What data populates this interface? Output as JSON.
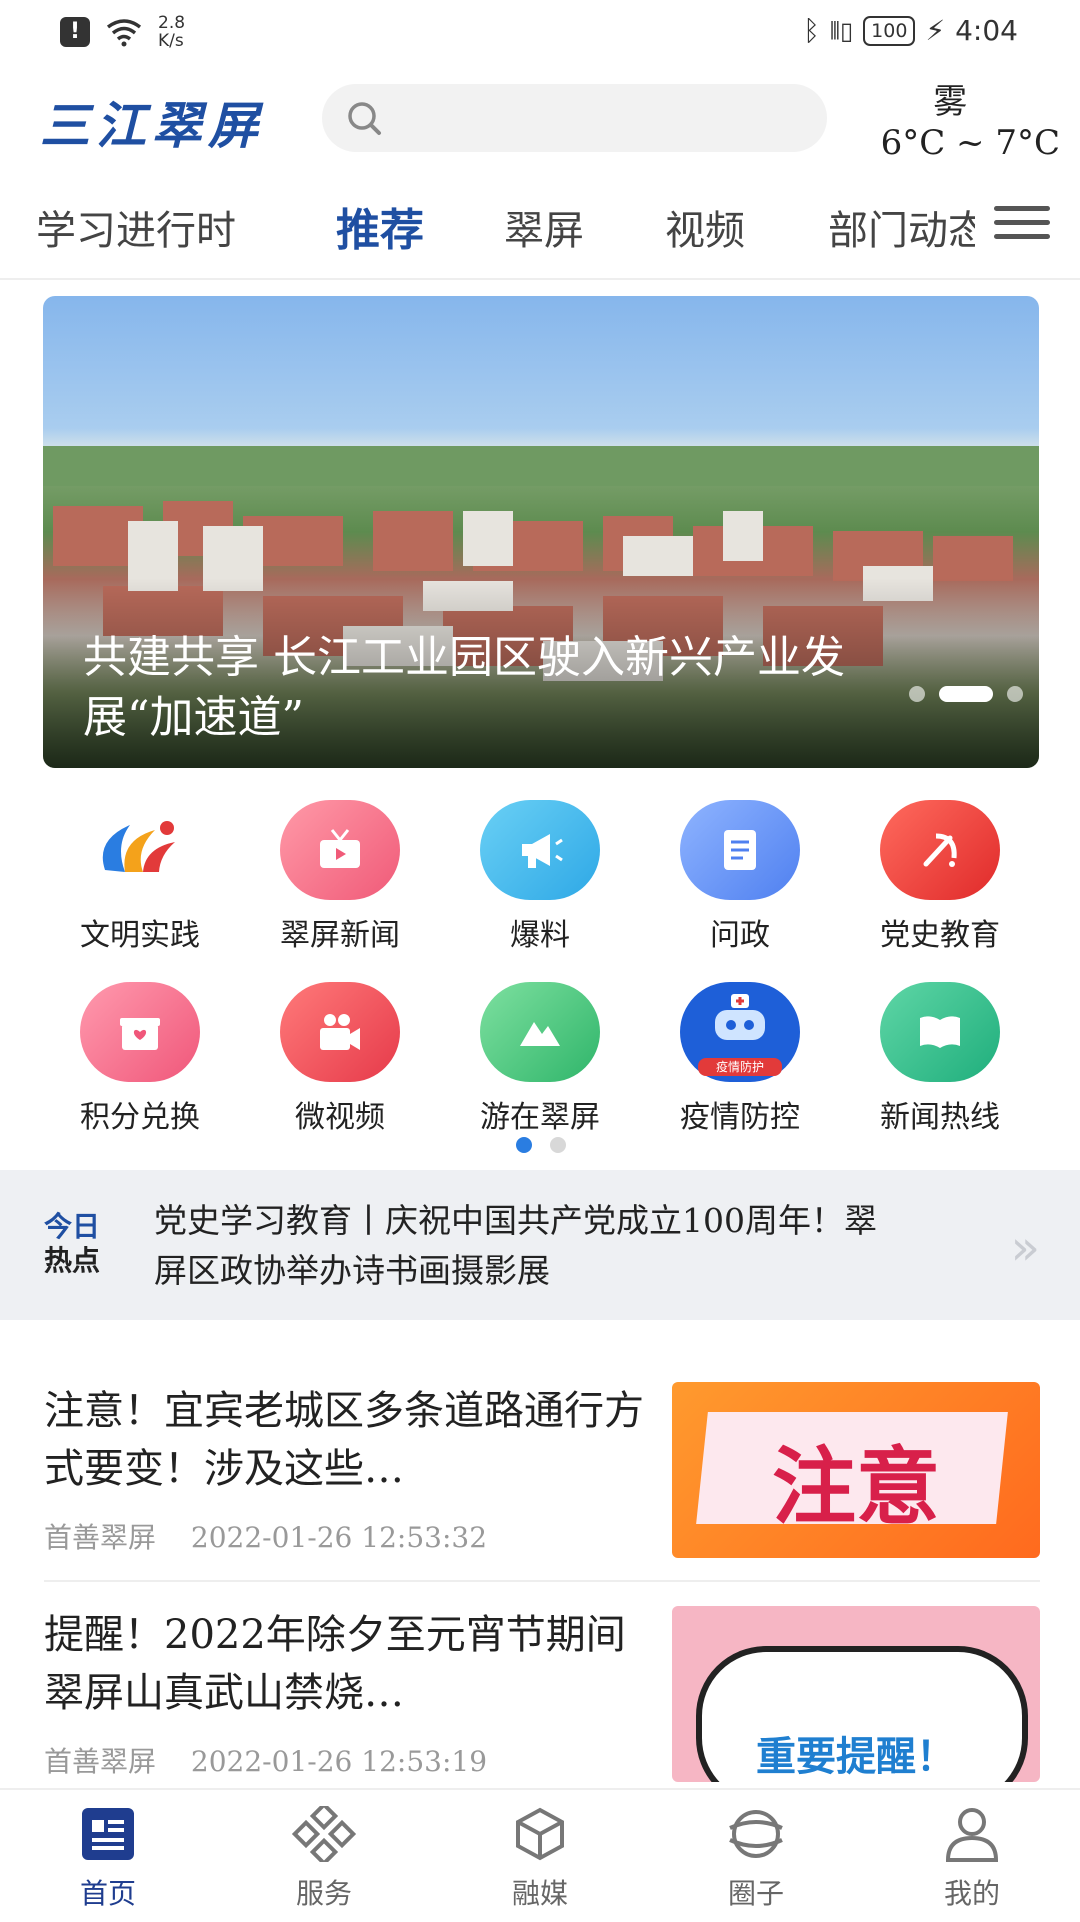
{
  "status_bar": {
    "network_speed_value": "2.8",
    "network_speed_unit": "K/s",
    "battery": "100",
    "time": "4:04",
    "icons": [
      "alert-icon",
      "wifi-icon",
      "bluetooth-icon",
      "vibrate-icon",
      "battery-icon",
      "charging-icon"
    ]
  },
  "header": {
    "logo_text": "三江翠屏",
    "search_placeholder": "",
    "weather_condition": "雾",
    "weather_range": "6°C ~ 7°C"
  },
  "tabs": [
    {
      "label": "学习进行时",
      "active": false
    },
    {
      "label": "推荐",
      "active": true
    },
    {
      "label": "翠屏",
      "active": false
    },
    {
      "label": "视频",
      "active": false
    },
    {
      "label": "部门动态",
      "active": false
    }
  ],
  "banner": {
    "caption": "共建共享 长江工业园区驶入新兴产业发展“加速道”",
    "slide_count": 3,
    "active_slide": 2
  },
  "services": {
    "row1": [
      {
        "label": "文明实践",
        "icon": "civilization-logo-icon"
      },
      {
        "label": "翠屏新闻",
        "icon": "tv-icon"
      },
      {
        "label": "爆料",
        "icon": "megaphone-icon"
      },
      {
        "label": "问政",
        "icon": "document-icon"
      },
      {
        "label": "党史教育",
        "icon": "party-emblem-icon"
      }
    ],
    "row2": [
      {
        "label": "积分兑换",
        "icon": "gift-icon"
      },
      {
        "label": "微视频",
        "icon": "video-camera-icon"
      },
      {
        "label": "游在翠屏",
        "icon": "mountain-icon"
      },
      {
        "label": "疫情防控",
        "icon": "robot-icon",
        "badge": "疫情防护"
      },
      {
        "label": "新闻热线",
        "icon": "book-icon"
      }
    ],
    "page_count": 2,
    "active_page": 1
  },
  "hot": {
    "tag_line1": "今日",
    "tag_line2": "热点",
    "text": "党史学习教育丨庆祝中国共产党成立100周年！翠屏区政协举办诗书画摄影展"
  },
  "news": [
    {
      "title": "注意！宜宾老城区多条道路通行方式要变！涉及这些…",
      "source": "首善翠屏",
      "time": "2022-01-26 12:53:32",
      "thumb_text": "注意"
    },
    {
      "title": "提醒！2022年除夕至元宵节期间 翠屏山真武山禁烧…",
      "source": "首善翠屏",
      "time": "2022-01-26 12:53:19",
      "thumb_text": "重要提醒！"
    }
  ],
  "bottom_nav": [
    {
      "label": "首页",
      "icon": "home-news-icon",
      "active": true
    },
    {
      "label": "服务",
      "icon": "service-grid-icon",
      "active": false
    },
    {
      "label": "融媒",
      "icon": "cube-icon",
      "active": false
    },
    {
      "label": "圈子",
      "icon": "circle-icon",
      "active": false
    },
    {
      "label": "我的",
      "icon": "user-icon",
      "active": false
    }
  ],
  "colors": {
    "brand": "#1f4fa2",
    "nav_active": "#1f3d8f",
    "dot_active": "#2a7de1"
  }
}
